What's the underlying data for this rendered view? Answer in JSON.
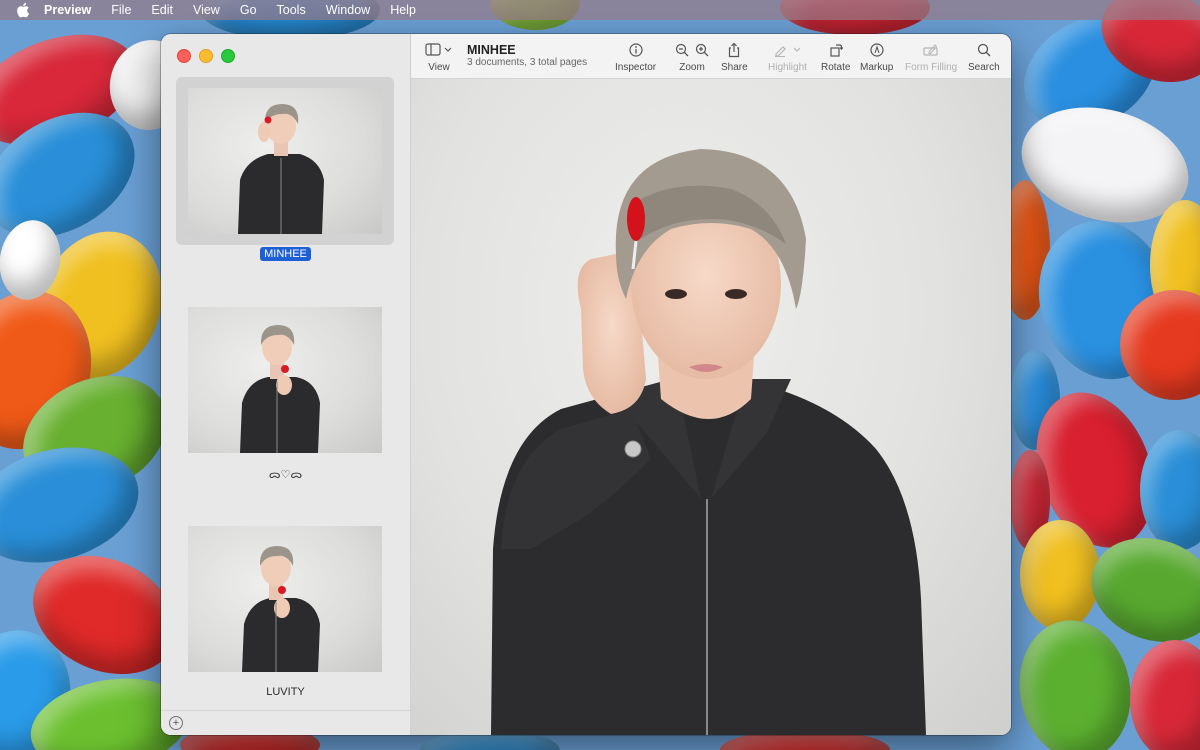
{
  "menubar": {
    "app_name": "Preview",
    "items": [
      "File",
      "Edit",
      "View",
      "Go",
      "Tools",
      "Window",
      "Help"
    ]
  },
  "window": {
    "title": "MINHEE",
    "subtitle": "3 documents, 3 total pages"
  },
  "toolbar": {
    "view_label": "View",
    "inspector_label": "Inspector",
    "zoom_label": "Zoom",
    "share_label": "Share",
    "highlight_label": "Highlight",
    "rotate_label": "Rotate",
    "markup_label": "Markup",
    "form_filling_label": "Form Filling",
    "search_label": "Search"
  },
  "sidebar": {
    "thumbnails": [
      {
        "label": "MINHEE",
        "selected": true
      },
      {
        "label": "ᯅ♡ᯅ",
        "selected": false
      },
      {
        "label": "LUVITY",
        "selected": false
      }
    ],
    "add_icon": "plus-circle-icon"
  },
  "colors": {
    "selection": "#1d5fd6",
    "close": "#fe5f57",
    "minimize": "#febc2e",
    "zoom": "#28c840"
  }
}
